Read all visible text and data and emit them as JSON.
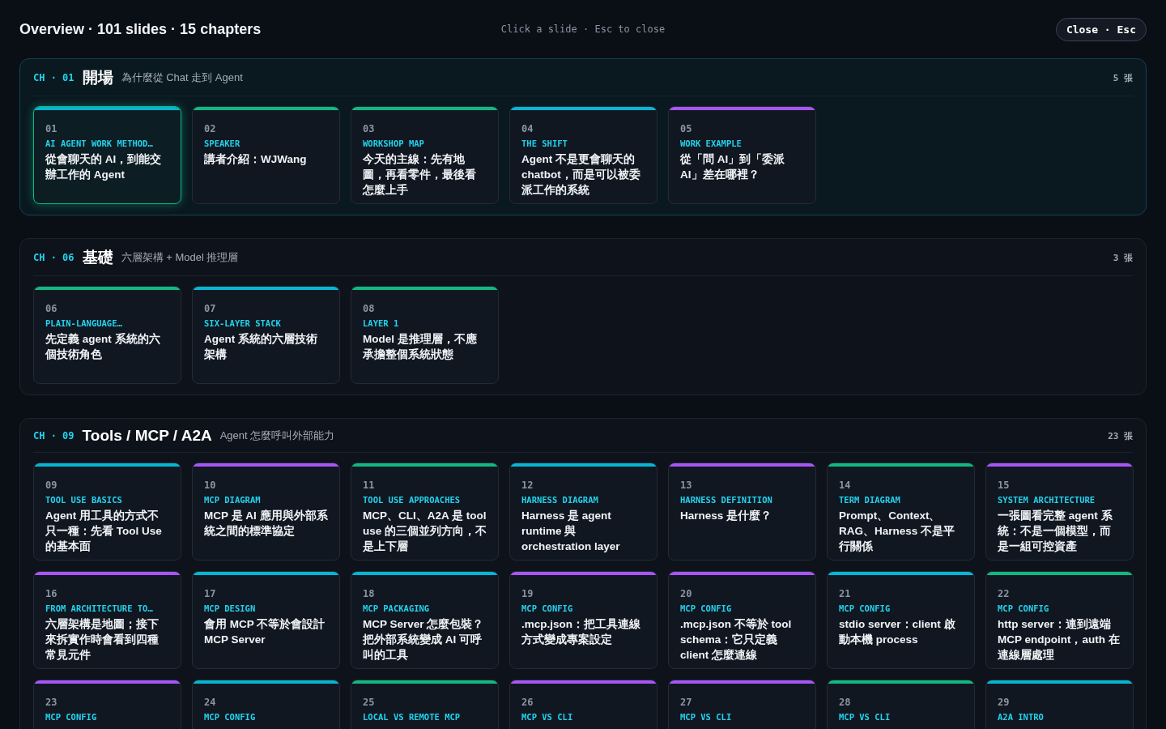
{
  "header": {
    "title": "Overview · 101 slides · 15 chapters",
    "hint": "Click a slide · Esc to close",
    "close_button": "Close · Esc"
  },
  "chapters": [
    {
      "label": "CH · 01",
      "name": "開場",
      "subtitle": "為什麼從 Chat 走到 Agent",
      "count": "5 張",
      "current": true,
      "slides": [
        {
          "num": "01",
          "tag": "AI AGENT WORK METHOD…",
          "title": "從會聊天的 AI，到能交辦工作的 Agent",
          "color": "#06b6d4",
          "selected": true
        },
        {
          "num": "02",
          "tag": "SPEAKER",
          "title": "講者介紹：WJWang",
          "color": "#10b981",
          "selected": false
        },
        {
          "num": "03",
          "tag": "WORKSHOP MAP",
          "title": "今天的主線：先有地圖，再看零件，最後看怎麼上手",
          "color": "#10b981",
          "selected": false
        },
        {
          "num": "04",
          "tag": "THE SHIFT",
          "title": "Agent 不是更會聊天的 chatbot，而是可以被委派工作的系統",
          "color": "#06b6d4",
          "selected": false
        },
        {
          "num": "05",
          "tag": "WORK EXAMPLE",
          "title": "從「問 AI」到「委派 AI」差在哪裡？",
          "color": "#a855f7",
          "selected": false
        }
      ]
    },
    {
      "label": "CH · 06",
      "name": "基礎",
      "subtitle": "六層架構 + Model 推理層",
      "count": "3 張",
      "current": false,
      "slides": [
        {
          "num": "06",
          "tag": "PLAIN-LANGUAGE…",
          "title": "先定義 agent 系統的六個技術角色",
          "color": "#10b981",
          "selected": false
        },
        {
          "num": "07",
          "tag": "SIX-LAYER STACK",
          "title": "Agent 系統的六層技術架構",
          "color": "#06b6d4",
          "selected": false
        },
        {
          "num": "08",
          "tag": "LAYER 1",
          "title": "Model 是推理層，不應承擔整個系統狀態",
          "color": "#10b981",
          "selected": false
        }
      ]
    },
    {
      "label": "CH · 09",
      "name": "Tools / MCP / A2A",
      "subtitle": "Agent 怎麼呼叫外部能力",
      "count": "23 張",
      "current": false,
      "slides": [
        {
          "num": "09",
          "tag": "TOOL USE BASICS",
          "title": "Agent 用工具的方式不只一種：先看 Tool Use 的基本面",
          "color": "#06b6d4",
          "selected": false
        },
        {
          "num": "10",
          "tag": "MCP DIAGRAM",
          "title": "MCP 是 AI 應用與外部系統之間的標準協定",
          "color": "#a855f7",
          "selected": false
        },
        {
          "num": "11",
          "tag": "TOOL USE APPROACHES",
          "title": "MCP、CLI、A2A 是 tool use 的三個並列方向，不是上下層",
          "color": "#10b981",
          "selected": false
        },
        {
          "num": "12",
          "tag": "HARNESS DIAGRAM",
          "title": "Harness 是 agent runtime 與 orchestration layer",
          "color": "#06b6d4",
          "selected": false
        },
        {
          "num": "13",
          "tag": "HARNESS DEFINITION",
          "title": "Harness 是什麼？",
          "color": "#a855f7",
          "selected": false
        },
        {
          "num": "14",
          "tag": "TERM DIAGRAM",
          "title": "Prompt、Context、RAG、Harness 不是平行關係",
          "color": "#10b981",
          "selected": false
        },
        {
          "num": "15",
          "tag": "SYSTEM ARCHITECTURE",
          "title": "一張圖看完整 agent 系統：不是一個模型，而是一組可控資產",
          "color": "#a855f7",
          "selected": false
        },
        {
          "num": "16",
          "tag": "FROM ARCHITECTURE TO…",
          "title": "六層架構是地圖；接下來拆實作時會看到四種常見元件",
          "color": "#a855f7",
          "selected": false
        },
        {
          "num": "17",
          "tag": "MCP DESIGN",
          "title": "會用 MCP 不等於會設計 MCP Server",
          "color": "#06b6d4",
          "selected": false
        },
        {
          "num": "18",
          "tag": "MCP PACKAGING",
          "title": "MCP Server 怎麼包裝？把外部系統變成 AI 可呼叫的工具",
          "color": "#06b6d4",
          "selected": false
        },
        {
          "num": "19",
          "tag": "MCP CONFIG",
          "title": ".mcp.json：把工具連線方式變成專案設定",
          "color": "#a855f7",
          "selected": false
        },
        {
          "num": "20",
          "tag": "MCP CONFIG",
          "title": ".mcp.json 不等於 tool schema：它只定義 client 怎麼連線",
          "color": "#a855f7",
          "selected": false
        },
        {
          "num": "21",
          "tag": "MCP CONFIG",
          "title": "stdio server：client 啟動本機 process",
          "color": "#06b6d4",
          "selected": false
        },
        {
          "num": "22",
          "tag": "MCP CONFIG",
          "title": "http server：連到遠端 MCP endpoint，auth 在連線層處理",
          "color": "#10b981",
          "selected": false
        },
        {
          "num": "23",
          "tag": "MCP CONFIG",
          "color": "#a855f7",
          "selected": false
        },
        {
          "num": "24",
          "tag": "MCP CONFIG",
          "color": "#06b6d4",
          "selected": false
        },
        {
          "num": "25",
          "tag": "LOCAL VS REMOTE MCP",
          "color": "#10b981",
          "selected": false
        },
        {
          "num": "26",
          "tag": "MCP VS CLI",
          "color": "#a855f7",
          "selected": false
        },
        {
          "num": "27",
          "tag": "MCP VS CLI",
          "color": "#a855f7",
          "selected": false
        },
        {
          "num": "28",
          "tag": "MCP VS CLI",
          "color": "#10b981",
          "selected": false
        },
        {
          "num": "29",
          "tag": "A2A INTRO",
          "color": "#06b6d4",
          "selected": false
        }
      ]
    }
  ]
}
